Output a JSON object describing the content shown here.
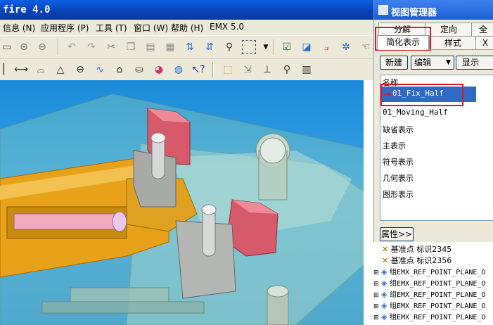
{
  "app": {
    "title": "fire 4.0"
  },
  "menu": {
    "items": [
      "信息 (N)",
      "应用程序 (P)",
      "工具 (T)",
      "窗口 (W)",
      "帮助 (H)",
      "EMX 5.0"
    ]
  },
  "view_manager": {
    "title": "视图管理器",
    "tabs_row1": [
      "分解",
      "定向",
      "全"
    ],
    "tabs_row2": [
      "简化表示",
      "样式",
      "X"
    ],
    "buttons": {
      "new": "新建",
      "edit": "编辑",
      "display": "显示"
    },
    "list_header": "名称",
    "items": [
      "01_Fix_Half",
      "01_Moving_Half",
      "缺省表示",
      "主表示",
      "符号表示",
      "几何表示",
      "图形表示"
    ],
    "properties_button": "属性>>"
  },
  "tree": {
    "items": [
      "基准点 标识2345",
      "基准点 标识2356",
      "组EMX_REF_POINT_PLANE_O",
      "组EMX_REF_POINT_PLANE_O",
      "组EMX_REF_POINT_PLANE_O",
      "组EMX_REF_POINT_PLANE_O",
      "组EMX_REF_POINT_PLANE_O"
    ]
  },
  "colors": {
    "highlight": "#e4141e",
    "selection": "#316ac5",
    "viewport_bg": "#2c90d6"
  }
}
